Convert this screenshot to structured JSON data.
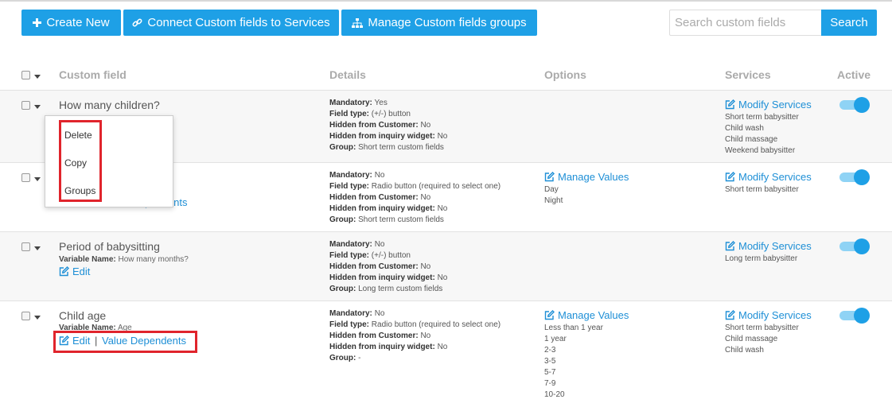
{
  "toolbar": {
    "create_new": "Create New",
    "connect_services": "Connect Custom fields to Services",
    "manage_groups": "Manage Custom fields groups",
    "search_placeholder": "Search custom fields",
    "search_button": "Search"
  },
  "columns": {
    "custom_field": "Custom field",
    "details": "Details",
    "options": "Options",
    "services": "Services",
    "active": "Active"
  },
  "labels": {
    "mandatory": "Mandatory:",
    "field_type": "Field type:",
    "hidden_customer": "Hidden from Customer:",
    "hidden_widget": "Hidden from inquiry widget:",
    "group": "Group:",
    "variable_name": "Variable Name:",
    "edit": "Edit",
    "value_dependents": "Value Dependents",
    "manage_values": "Manage Values",
    "modify_services": "Modify Services",
    "pendents_fragment": "pendents"
  },
  "dropdown": {
    "delete": "Delete",
    "copy": "Copy",
    "groups": "Groups"
  },
  "rows": [
    {
      "title": "How many children?",
      "mandatory": "Yes",
      "field_type": "(+/-) button",
      "hidden_customer": "No",
      "hidden_widget": "No",
      "group": "Short term custom fields",
      "services": [
        "Short term babysitter",
        "Child wash",
        "Child massage",
        "Weekend babysitter"
      ],
      "active": true
    },
    {
      "title": "",
      "mandatory": "No",
      "field_type": "Radio button (required to select one)",
      "hidden_customer": "No",
      "hidden_widget": "No",
      "group": "Short term custom fields",
      "options": [
        "Day",
        "Night"
      ],
      "services": [
        "Short term babysitter"
      ],
      "active": true
    },
    {
      "title": "Period of babysitting",
      "variable_name": "How many months?",
      "mandatory": "No",
      "field_type": "(+/-) button",
      "hidden_customer": "No",
      "hidden_widget": "No",
      "group": "Long term custom fields",
      "services": [
        "Long term babysitter"
      ],
      "active": true
    },
    {
      "title": "Child age",
      "variable_name": "Age",
      "mandatory": "No",
      "field_type": "Radio button (required to select one)",
      "hidden_customer": "No",
      "hidden_widget": "No",
      "group": "-",
      "options": [
        "Less than 1 year",
        "1 year",
        "2-3",
        "3-5",
        "5-7",
        "7-9",
        "10-20"
      ],
      "services": [
        "Short term babysitter",
        "Child massage",
        "Child wash"
      ],
      "active": true
    }
  ],
  "colors": {
    "primary": "#1ea0e6",
    "link": "#1e8fd6",
    "highlight": "#e0242c"
  }
}
